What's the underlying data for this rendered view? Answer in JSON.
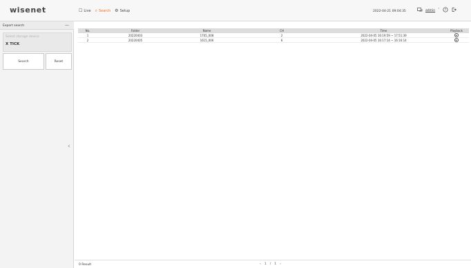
{
  "header": {
    "logo": "wisenet",
    "nav": [
      {
        "icon": "☐",
        "icon_name": "monitor-icon",
        "label": "Live"
      },
      {
        "icon": "⌕",
        "icon_name": "search-icon",
        "label": "Search"
      },
      {
        "icon": "⚙",
        "icon_name": "gear-icon",
        "label": "Setup"
      }
    ],
    "datetime": "2022-04-21 09:04:35",
    "user": "admin",
    "accent_color": "#f37021"
  },
  "panel": {
    "title": "Export search",
    "collapse_symbol": "—",
    "device_placeholder": "Select storage device",
    "device_value": "X TICK",
    "search_label": "Search",
    "reset_label": "Reset",
    "toggle_symbol": "‹"
  },
  "table": {
    "headers": [
      "No.",
      "Folder",
      "Name",
      "CH",
      "Time",
      "Playback"
    ],
    "rows": [
      {
        "no": "1",
        "folder": "20220403",
        "name": "1705_008",
        "ch": "2",
        "time": "2022-04-05 16:19:59 ~ 17:51:39"
      },
      {
        "no": "2",
        "folder": "20220405",
        "name": "1615_006",
        "ch": "6",
        "time": "2022-04-05 16:17:14 ~ 16:16:14"
      }
    ]
  },
  "footer": {
    "result": "0 Result",
    "prev": "‹",
    "page": "1",
    "separator": "/",
    "total": "1",
    "next": "›"
  }
}
